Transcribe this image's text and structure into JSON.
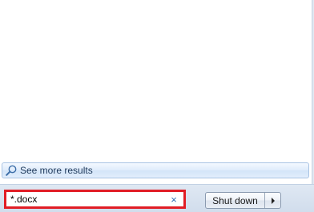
{
  "results": {
    "see_more_label": "See more results",
    "see_more_icon": "search-icon"
  },
  "search": {
    "value": "*.docx",
    "clear_icon": "close-icon",
    "clear_glyph": "×"
  },
  "power": {
    "shutdown_label": "Shut down",
    "options_icon": "chevron-right-icon"
  },
  "colors": {
    "highlight_border": "#e11d25",
    "clear_icon": "#2f6fb7",
    "see_more_text": "#1e395b"
  }
}
